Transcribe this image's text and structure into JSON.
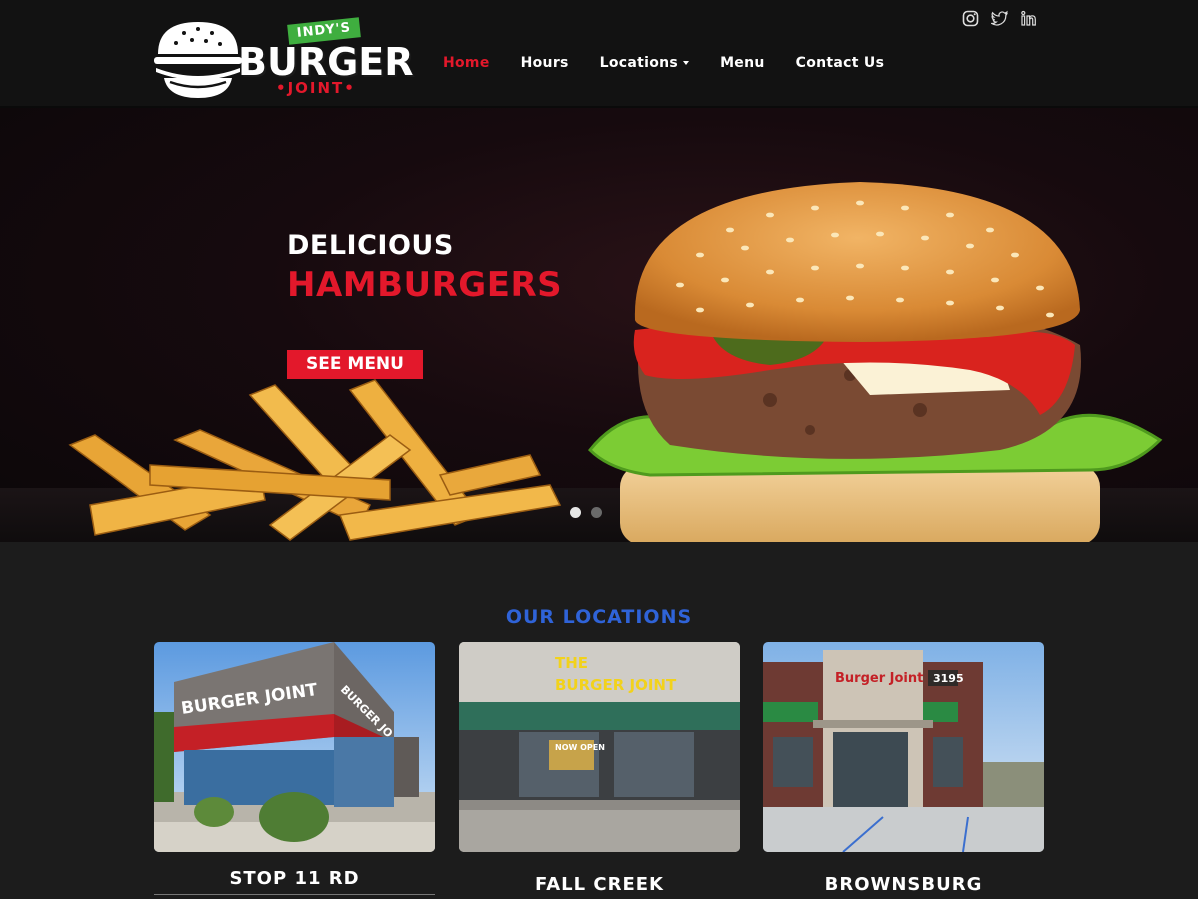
{
  "logo": {
    "banner": "INDY'S",
    "word": "BURGER",
    "sub": "•JOINT•"
  },
  "nav": {
    "items": [
      {
        "label": "Home",
        "active": true
      },
      {
        "label": "Hours"
      },
      {
        "label": "Locations",
        "dropdown": true
      },
      {
        "label": "Menu"
      },
      {
        "label": "Contact Us"
      }
    ]
  },
  "social": [
    "instagram-icon",
    "twitter-icon",
    "linkedin-icon"
  ],
  "hero": {
    "line1": "DELICIOUS",
    "line2": "HAMBURGERS",
    "button": "SEE MENU",
    "slides": 2,
    "active_slide": 1
  },
  "locations": {
    "heading": "OUR LOCATIONS",
    "cards": [
      {
        "name": "STOP 11 RD",
        "sign": "BURGER JOINT",
        "sign_side": "BURGER JO"
      },
      {
        "name": "FALL CREEK",
        "sign_line1": "THE",
        "sign_line2": "BURGER JOINT",
        "now_open": "NOW OPEN"
      },
      {
        "name": "BROWNSBURG",
        "sign": "Burger Joint",
        "number": "3195"
      }
    ]
  },
  "colors": {
    "accent_red": "#e3182b",
    "heading_blue": "#2f63d8",
    "header_bg": "#121212",
    "page_bg": "#1c1c1c"
  }
}
